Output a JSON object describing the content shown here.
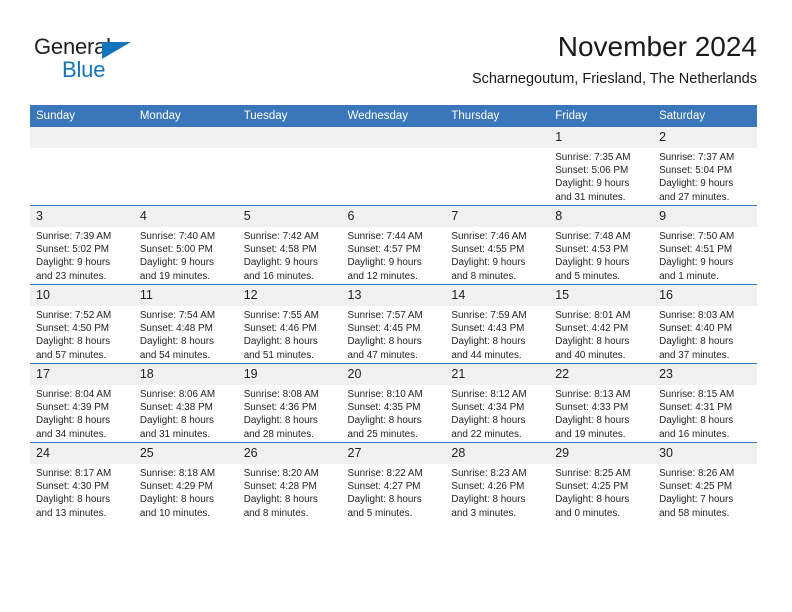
{
  "brand": {
    "name_dark": "General",
    "name_blue": "Blue",
    "accent_color": "#1275bc"
  },
  "header": {
    "title": "November 2024",
    "subtitle": "Scharnegoutum, Friesland, The Netherlands",
    "header_bg": "#3a77ba",
    "daynum_bg": "#f0f0f0"
  },
  "weekdays": [
    "Sunday",
    "Monday",
    "Tuesday",
    "Wednesday",
    "Thursday",
    "Friday",
    "Saturday"
  ],
  "labels": {
    "sunrise_prefix": "Sunrise:",
    "sunset_prefix": "Sunset:",
    "daylight_prefix": "Daylight:"
  },
  "weeks": [
    [
      {
        "day": "",
        "empty": true
      },
      {
        "day": "",
        "empty": true
      },
      {
        "day": "",
        "empty": true
      },
      {
        "day": "",
        "empty": true
      },
      {
        "day": "",
        "empty": true
      },
      {
        "day": "1",
        "sunrise": "Sunrise: 7:35 AM",
        "sunset": "Sunset: 5:06 PM",
        "daylight_1": "Daylight: 9 hours",
        "daylight_2": "and 31 minutes."
      },
      {
        "day": "2",
        "sunrise": "Sunrise: 7:37 AM",
        "sunset": "Sunset: 5:04 PM",
        "daylight_1": "Daylight: 9 hours",
        "daylight_2": "and 27 minutes."
      }
    ],
    [
      {
        "day": "3",
        "sunrise": "Sunrise: 7:39 AM",
        "sunset": "Sunset: 5:02 PM",
        "daylight_1": "Daylight: 9 hours",
        "daylight_2": "and 23 minutes."
      },
      {
        "day": "4",
        "sunrise": "Sunrise: 7:40 AM",
        "sunset": "Sunset: 5:00 PM",
        "daylight_1": "Daylight: 9 hours",
        "daylight_2": "and 19 minutes."
      },
      {
        "day": "5",
        "sunrise": "Sunrise: 7:42 AM",
        "sunset": "Sunset: 4:58 PM",
        "daylight_1": "Daylight: 9 hours",
        "daylight_2": "and 16 minutes."
      },
      {
        "day": "6",
        "sunrise": "Sunrise: 7:44 AM",
        "sunset": "Sunset: 4:57 PM",
        "daylight_1": "Daylight: 9 hours",
        "daylight_2": "and 12 minutes."
      },
      {
        "day": "7",
        "sunrise": "Sunrise: 7:46 AM",
        "sunset": "Sunset: 4:55 PM",
        "daylight_1": "Daylight: 9 hours",
        "daylight_2": "and 8 minutes."
      },
      {
        "day": "8",
        "sunrise": "Sunrise: 7:48 AM",
        "sunset": "Sunset: 4:53 PM",
        "daylight_1": "Daylight: 9 hours",
        "daylight_2": "and 5 minutes."
      },
      {
        "day": "9",
        "sunrise": "Sunrise: 7:50 AM",
        "sunset": "Sunset: 4:51 PM",
        "daylight_1": "Daylight: 9 hours",
        "daylight_2": "and 1 minute."
      }
    ],
    [
      {
        "day": "10",
        "sunrise": "Sunrise: 7:52 AM",
        "sunset": "Sunset: 4:50 PM",
        "daylight_1": "Daylight: 8 hours",
        "daylight_2": "and 57 minutes."
      },
      {
        "day": "11",
        "sunrise": "Sunrise: 7:54 AM",
        "sunset": "Sunset: 4:48 PM",
        "daylight_1": "Daylight: 8 hours",
        "daylight_2": "and 54 minutes."
      },
      {
        "day": "12",
        "sunrise": "Sunrise: 7:55 AM",
        "sunset": "Sunset: 4:46 PM",
        "daylight_1": "Daylight: 8 hours",
        "daylight_2": "and 51 minutes."
      },
      {
        "day": "13",
        "sunrise": "Sunrise: 7:57 AM",
        "sunset": "Sunset: 4:45 PM",
        "daylight_1": "Daylight: 8 hours",
        "daylight_2": "and 47 minutes."
      },
      {
        "day": "14",
        "sunrise": "Sunrise: 7:59 AM",
        "sunset": "Sunset: 4:43 PM",
        "daylight_1": "Daylight: 8 hours",
        "daylight_2": "and 44 minutes."
      },
      {
        "day": "15",
        "sunrise": "Sunrise: 8:01 AM",
        "sunset": "Sunset: 4:42 PM",
        "daylight_1": "Daylight: 8 hours",
        "daylight_2": "and 40 minutes."
      },
      {
        "day": "16",
        "sunrise": "Sunrise: 8:03 AM",
        "sunset": "Sunset: 4:40 PM",
        "daylight_1": "Daylight: 8 hours",
        "daylight_2": "and 37 minutes."
      }
    ],
    [
      {
        "day": "17",
        "sunrise": "Sunrise: 8:04 AM",
        "sunset": "Sunset: 4:39 PM",
        "daylight_1": "Daylight: 8 hours",
        "daylight_2": "and 34 minutes."
      },
      {
        "day": "18",
        "sunrise": "Sunrise: 8:06 AM",
        "sunset": "Sunset: 4:38 PM",
        "daylight_1": "Daylight: 8 hours",
        "daylight_2": "and 31 minutes."
      },
      {
        "day": "19",
        "sunrise": "Sunrise: 8:08 AM",
        "sunset": "Sunset: 4:36 PM",
        "daylight_1": "Daylight: 8 hours",
        "daylight_2": "and 28 minutes."
      },
      {
        "day": "20",
        "sunrise": "Sunrise: 8:10 AM",
        "sunset": "Sunset: 4:35 PM",
        "daylight_1": "Daylight: 8 hours",
        "daylight_2": "and 25 minutes."
      },
      {
        "day": "21",
        "sunrise": "Sunrise: 8:12 AM",
        "sunset": "Sunset: 4:34 PM",
        "daylight_1": "Daylight: 8 hours",
        "daylight_2": "and 22 minutes."
      },
      {
        "day": "22",
        "sunrise": "Sunrise: 8:13 AM",
        "sunset": "Sunset: 4:33 PM",
        "daylight_1": "Daylight: 8 hours",
        "daylight_2": "and 19 minutes."
      },
      {
        "day": "23",
        "sunrise": "Sunrise: 8:15 AM",
        "sunset": "Sunset: 4:31 PM",
        "daylight_1": "Daylight: 8 hours",
        "daylight_2": "and 16 minutes."
      }
    ],
    [
      {
        "day": "24",
        "sunrise": "Sunrise: 8:17 AM",
        "sunset": "Sunset: 4:30 PM",
        "daylight_1": "Daylight: 8 hours",
        "daylight_2": "and 13 minutes."
      },
      {
        "day": "25",
        "sunrise": "Sunrise: 8:18 AM",
        "sunset": "Sunset: 4:29 PM",
        "daylight_1": "Daylight: 8 hours",
        "daylight_2": "and 10 minutes."
      },
      {
        "day": "26",
        "sunrise": "Sunrise: 8:20 AM",
        "sunset": "Sunset: 4:28 PM",
        "daylight_1": "Daylight: 8 hours",
        "daylight_2": "and 8 minutes."
      },
      {
        "day": "27",
        "sunrise": "Sunrise: 8:22 AM",
        "sunset": "Sunset: 4:27 PM",
        "daylight_1": "Daylight: 8 hours",
        "daylight_2": "and 5 minutes."
      },
      {
        "day": "28",
        "sunrise": "Sunrise: 8:23 AM",
        "sunset": "Sunset: 4:26 PM",
        "daylight_1": "Daylight: 8 hours",
        "daylight_2": "and 3 minutes."
      },
      {
        "day": "29",
        "sunrise": "Sunrise: 8:25 AM",
        "sunset": "Sunset: 4:25 PM",
        "daylight_1": "Daylight: 8 hours",
        "daylight_2": "and 0 minutes."
      },
      {
        "day": "30",
        "sunrise": "Sunrise: 8:26 AM",
        "sunset": "Sunset: 4:25 PM",
        "daylight_1": "Daylight: 7 hours",
        "daylight_2": "and 58 minutes."
      }
    ]
  ]
}
